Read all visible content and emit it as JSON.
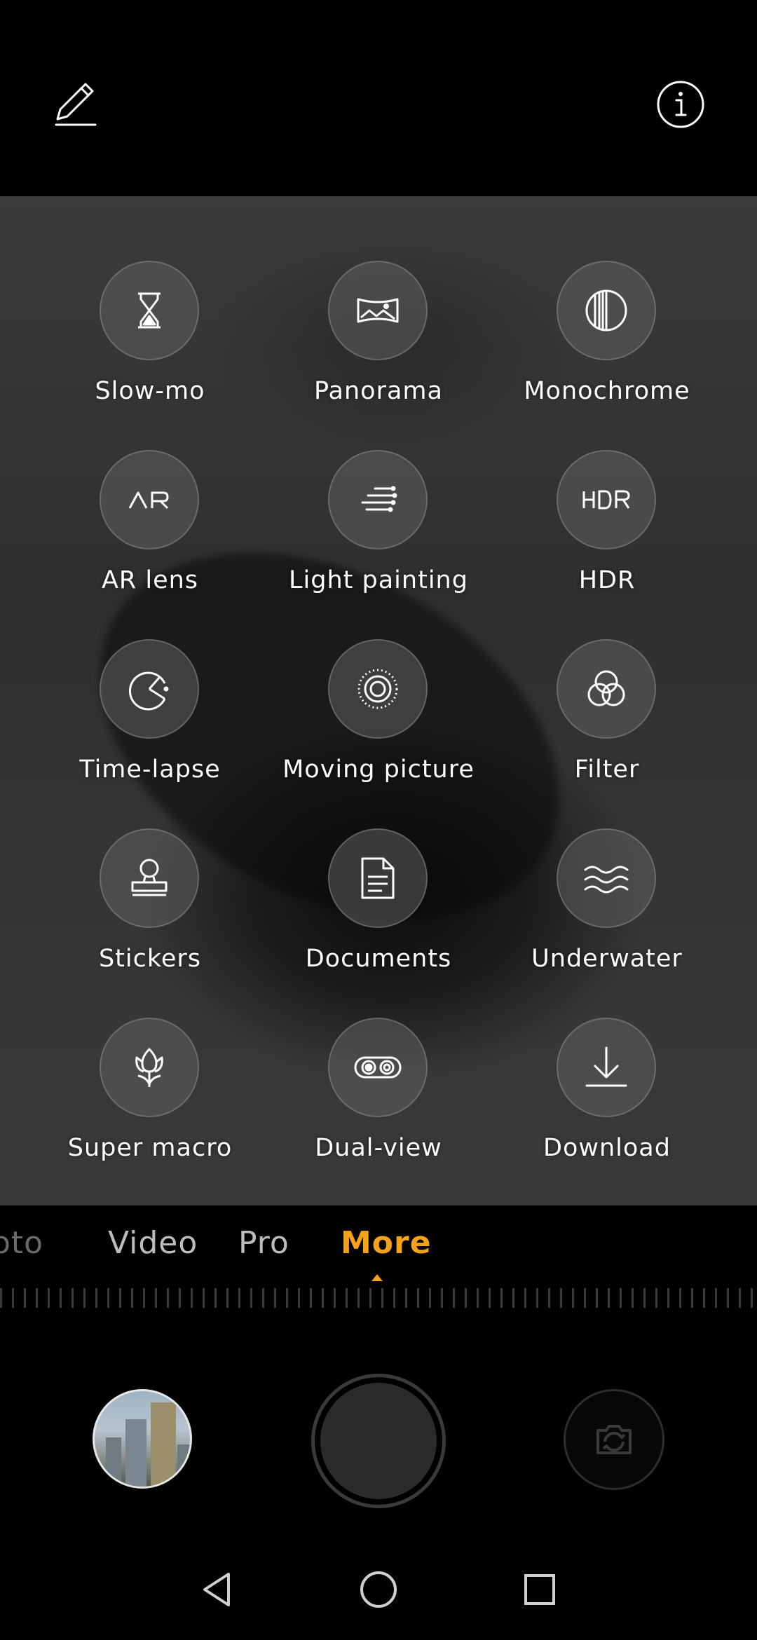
{
  "top_bar": {
    "edit_icon": "pencil-icon",
    "info_icon": "info-icon"
  },
  "modes": [
    {
      "label": "Slow-mo",
      "icon": "hourglass-icon"
    },
    {
      "label": "Panorama",
      "icon": "panorama-icon"
    },
    {
      "label": "Monochrome",
      "icon": "monochrome-icon"
    },
    {
      "label": "AR lens",
      "icon": "ar-icon"
    },
    {
      "label": "Light painting",
      "icon": "light-painting-icon"
    },
    {
      "label": "HDR",
      "icon": "hdr-icon"
    },
    {
      "label": "Time-lapse",
      "icon": "timelapse-icon"
    },
    {
      "label": "Moving picture",
      "icon": "moving-picture-icon"
    },
    {
      "label": "Filter",
      "icon": "filter-icon"
    },
    {
      "label": "Stickers",
      "icon": "stamp-icon"
    },
    {
      "label": "Documents",
      "icon": "document-icon"
    },
    {
      "label": "Underwater",
      "icon": "waves-icon"
    },
    {
      "label": "Super macro",
      "icon": "flower-icon"
    },
    {
      "label": "Dual-view",
      "icon": "dual-view-icon"
    },
    {
      "label": "Download",
      "icon": "download-icon"
    }
  ],
  "hdr_icon_text": "HDR",
  "ar_icon_text": "AR",
  "mode_strip": {
    "tabs": [
      {
        "label": "oto"
      },
      {
        "label": "Video"
      },
      {
        "label": "Pro"
      },
      {
        "label": "More"
      }
    ],
    "active": "More",
    "accent_color": "#f5a21b"
  },
  "controls": {
    "gallery_icon": "gallery-thumbnail",
    "shutter_icon": "shutter-button",
    "switch_icon": "switch-camera-icon"
  },
  "nav": {
    "back": "back-icon",
    "home": "home-icon",
    "recents": "recents-icon"
  }
}
